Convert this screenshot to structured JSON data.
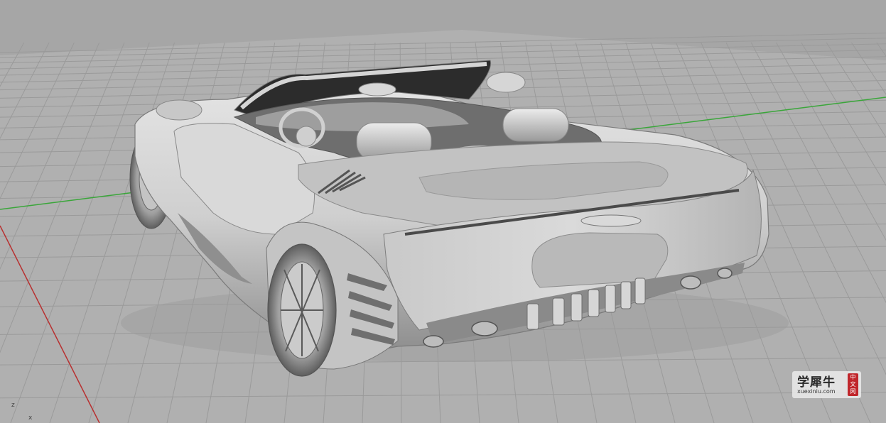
{
  "viewport": {
    "view_name": "Perspective",
    "display_mode": "shaded",
    "background_color": "#a8a8a8",
    "grid_color": "#9a9a9a",
    "x_axis_color": "#b83030",
    "y_axis_color": "#3aa63a",
    "model": "convertible-car-model",
    "axis_labels": {
      "z": "z",
      "x": "x"
    }
  },
  "watermark": {
    "title": "学犀牛",
    "url": "xuexiniu.com",
    "seal": [
      "中",
      "文",
      "网"
    ]
  }
}
